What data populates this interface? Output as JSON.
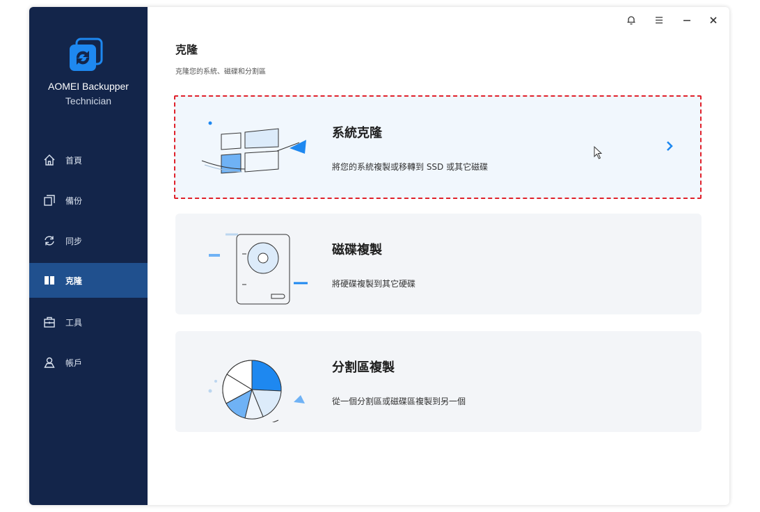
{
  "app": {
    "name": "AOMEI Backupper",
    "edition": "Technician"
  },
  "titlebar": {
    "icons": [
      "bell-icon",
      "menu-icon",
      "minimize-icon",
      "close-icon"
    ]
  },
  "sidebar": {
    "items": [
      {
        "label": "首頁",
        "icon": "home-icon",
        "active": false
      },
      {
        "label": "備份",
        "icon": "backup-icon",
        "active": false
      },
      {
        "label": "同步",
        "icon": "sync-icon",
        "active": false
      },
      {
        "label": "克隆",
        "icon": "clone-icon",
        "active": true
      },
      {
        "label": "工具",
        "icon": "toolbox-icon",
        "active": false
      },
      {
        "label": "帳戶",
        "icon": "account-icon",
        "active": false
      }
    ]
  },
  "main": {
    "title": "克隆",
    "subtitle": "克隆您的系統、磁碟和分割區",
    "cards": [
      {
        "title": "系統克隆",
        "description": "將您的系統複製或移轉到 SSD 或其它磁碟",
        "selected": true
      },
      {
        "title": "磁碟複製",
        "description": "將硬碟複製到其它硬碟",
        "selected": false
      },
      {
        "title": "分割區複製",
        "description": "從一個分割區或磁碟區複製到另一個",
        "selected": false
      }
    ]
  },
  "colors": {
    "sidebar_bg": "#13254a",
    "sidebar_active": "#20508e",
    "accent": "#1e88f0",
    "selection_border": "#e0202a",
    "card_bg": "#f3f5f8"
  }
}
